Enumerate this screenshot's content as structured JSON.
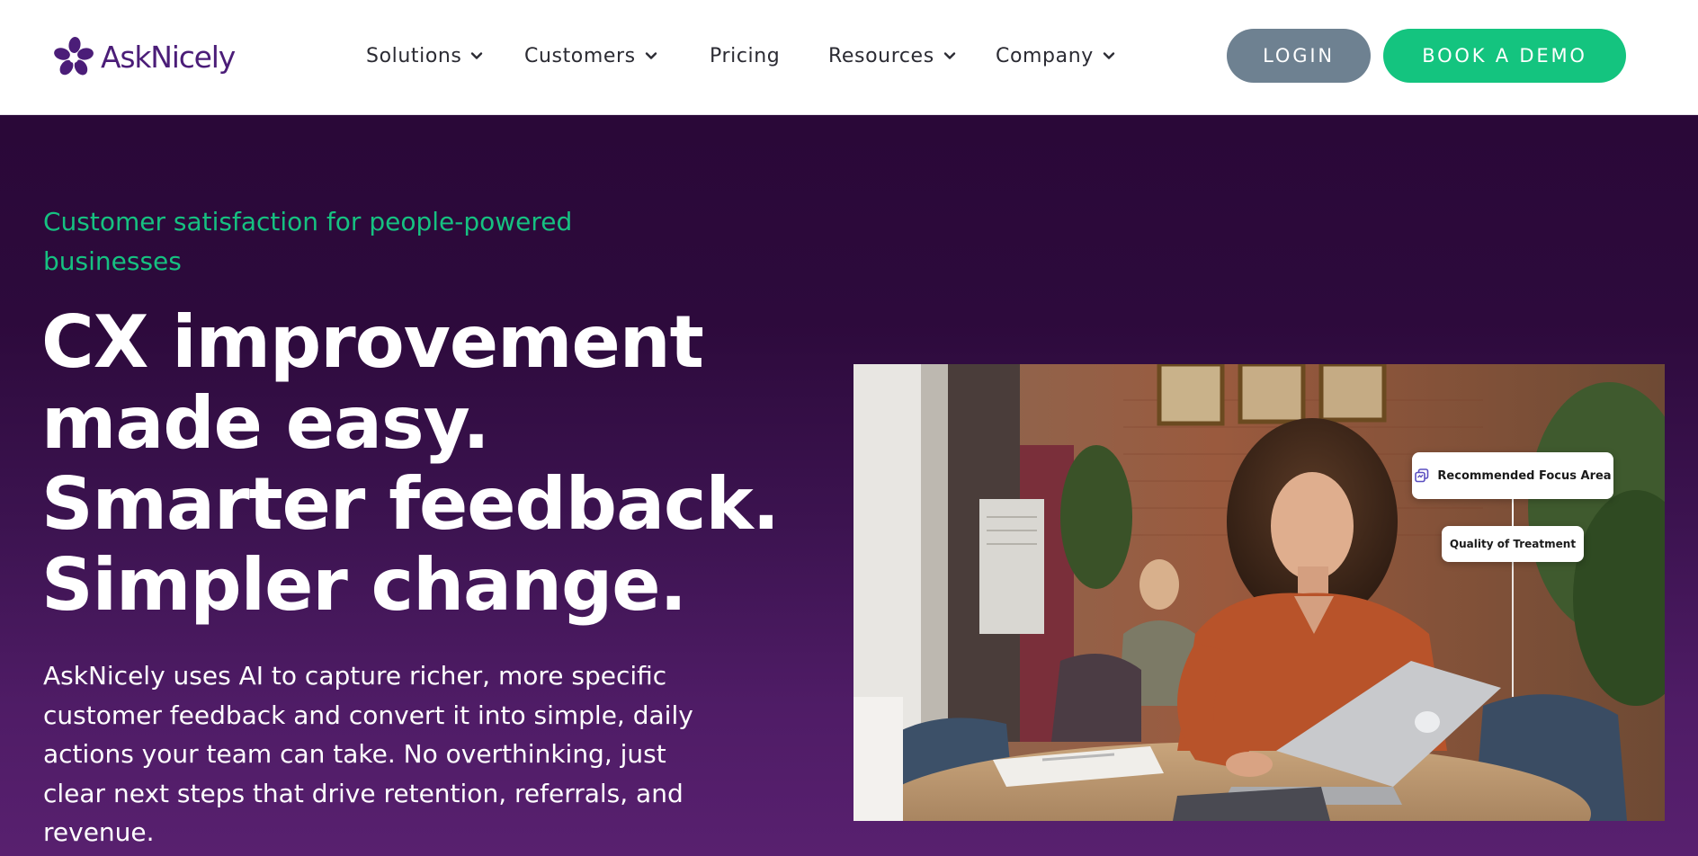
{
  "brand": {
    "name": "AskNicely",
    "logo_color": "#4b1d78"
  },
  "nav": {
    "items": [
      {
        "label": "Solutions",
        "has_dropdown": true,
        "icon": "chevron-down-icon"
      },
      {
        "label": "Customers",
        "has_dropdown": true,
        "icon": "chevron-down-icon"
      },
      {
        "label": "Pricing",
        "has_dropdown": false
      },
      {
        "label": "Resources",
        "has_dropdown": true,
        "icon": "chevron-down-icon"
      },
      {
        "label": "Company",
        "has_dropdown": true,
        "icon": "chevron-down-icon"
      }
    ],
    "login_label": "LOGIN",
    "demo_label": "BOOK A DEMO"
  },
  "hero": {
    "eyebrow": "Customer satisfaction for people-powered businesses",
    "headline_lines": [
      "CX improvement",
      "made easy.",
      "Smarter feedback.",
      "Simpler change."
    ],
    "body": "AskNicely uses AI to capture richer, more specific customer feedback and convert it into simple, daily actions your team can take. No overthinking, just clear next steps that drive retention, referrals, and revenue.",
    "image": {
      "overlay_focus_label": "Recommended Focus Area",
      "overlay_focus_icon": "copy-icon",
      "overlay_quality_label": "Quality of Treatment"
    }
  },
  "colors": {
    "accent_green": "#14c47f",
    "eyebrow_green": "#16c181",
    "login_gray": "#6e8191",
    "hero_dark_purple": "#2a0838",
    "hero_light_purple": "#58206f",
    "text_dark": "#2b2b33"
  }
}
